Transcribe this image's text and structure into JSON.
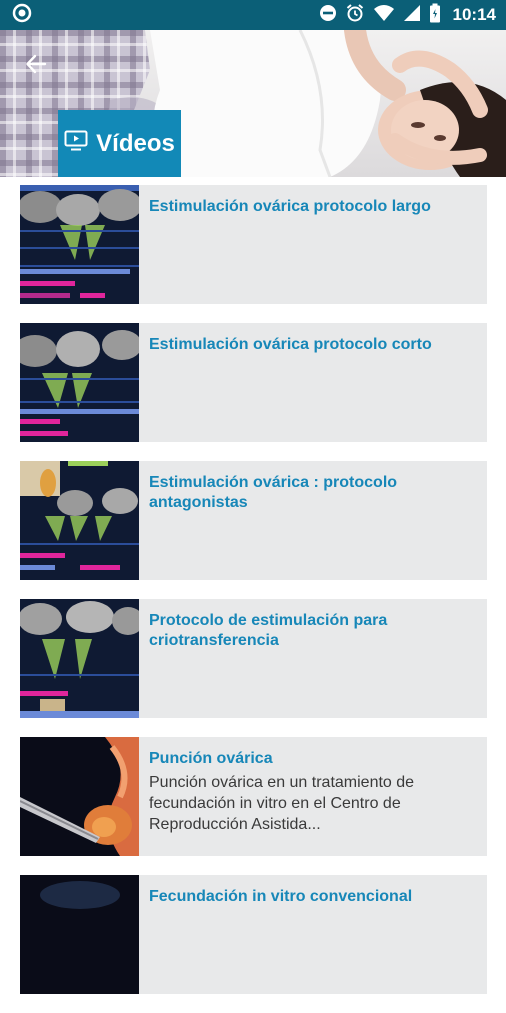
{
  "status_bar": {
    "time": "10:14",
    "icons": [
      "app-notification-icon",
      "do-not-disturb-icon",
      "alarm-icon",
      "wifi-icon",
      "signal-icon",
      "battery-icon"
    ]
  },
  "header": {
    "back_icon": "back-arrow-icon",
    "title_icon": "video-icon",
    "title": "Vídeos"
  },
  "videos": [
    {
      "title": "Estimulación ovárica protocolo largo",
      "description": ""
    },
    {
      "title": "Estimulación ovárica protocolo corto",
      "description": ""
    },
    {
      "title": "Estimulación ovárica : protocolo antagonistas",
      "description": ""
    },
    {
      "title": "Protocolo de estimulación para criotransferencia",
      "description": ""
    },
    {
      "title": "Punción ovárica",
      "description": "Punción ovárica en un tratamiento de fecundación in vitro en el Centro de Reproducción Asistida..."
    },
    {
      "title": "Fecundación in vitro convencional",
      "description": ""
    }
  ],
  "colors": {
    "status_bar": "#0b5f77",
    "accent": "#1289b7",
    "item_title": "#1787b8",
    "item_bg": "#e8e9ea"
  }
}
